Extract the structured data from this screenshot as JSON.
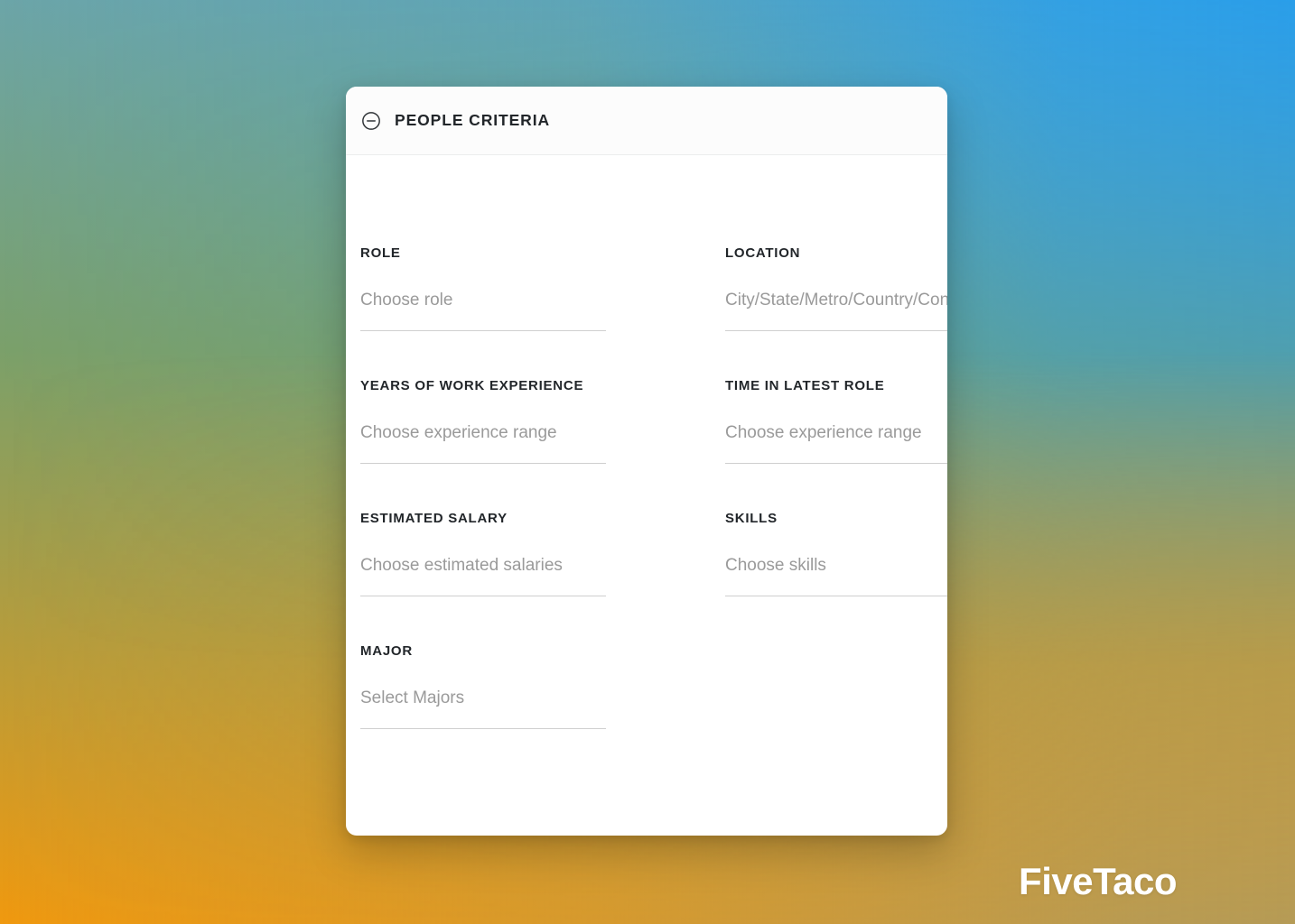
{
  "background": {
    "top_left_color": "#6ca5a8",
    "top_right_color": "#34a6e8",
    "bottom_left_color": "#f0990f",
    "bottom_right_color": "#b59b56"
  },
  "card": {
    "header": {
      "collapse_icon": "minus-circle-icon",
      "title": "PEOPLE CRITERIA"
    },
    "fields": [
      {
        "label": "ROLE",
        "placeholder": "Choose role",
        "value": ""
      },
      {
        "label": "LOCATION",
        "placeholder": "City/State/Metro/Country/Continent",
        "value": ""
      },
      {
        "label": "YEARS OF WORK EXPERIENCE",
        "placeholder": "Choose experience range",
        "value": ""
      },
      {
        "label": "TIME IN LATEST ROLE",
        "placeholder": "Choose experience range",
        "value": ""
      },
      {
        "label": "ESTIMATED SALARY",
        "placeholder": "Choose estimated salaries",
        "value": ""
      },
      {
        "label": "SKILLS",
        "placeholder": "Choose skills",
        "value": ""
      },
      {
        "label": "MAJOR",
        "placeholder": "Select Majors",
        "value": ""
      }
    ]
  },
  "watermark": {
    "text": "FiveTaco"
  }
}
